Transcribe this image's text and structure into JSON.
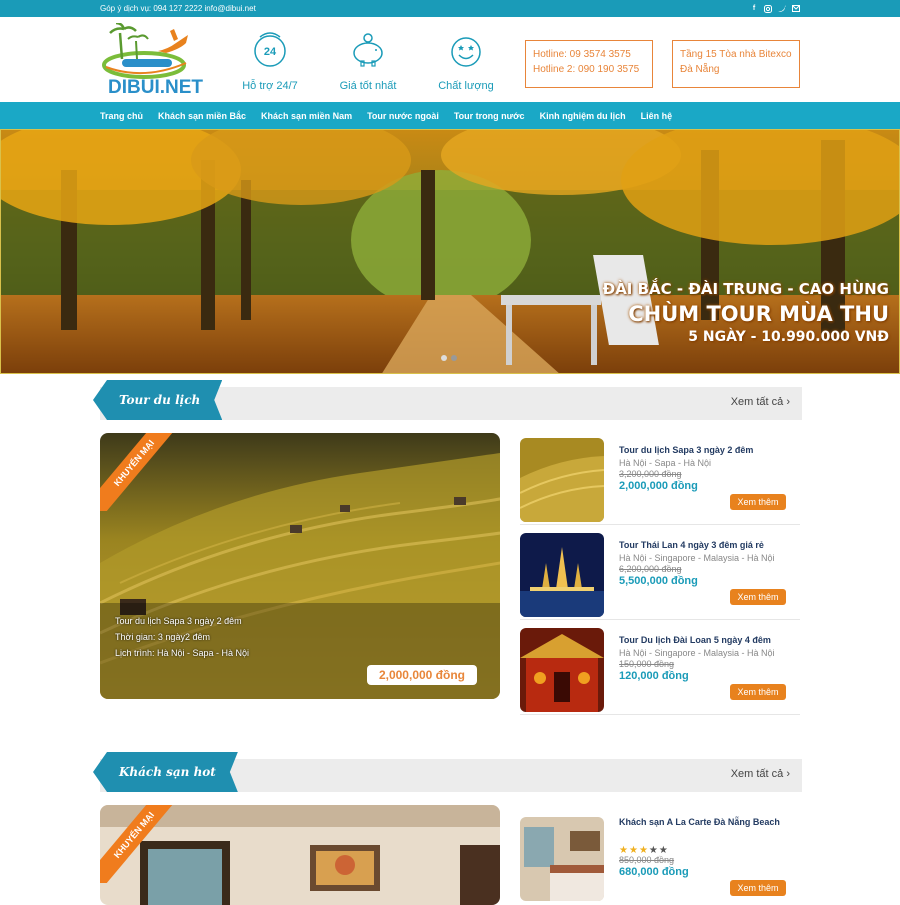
{
  "topbar": {
    "contact_text": "Góp ý dịch vụ: 094 127 2222 info@dibui.net",
    "social_icons": [
      "facebook-icon",
      "instagram-icon",
      "twitter-icon",
      "mail-icon"
    ]
  },
  "header": {
    "logo_text": "DIBUI.NET",
    "features": [
      {
        "label": "Hỗ trợ 24/7",
        "icon": "support-24-icon"
      },
      {
        "label": "Giá tốt nhất",
        "icon": "piggy-bank-icon"
      },
      {
        "label": "Chất lượng",
        "icon": "quality-icon"
      }
    ],
    "hotline_1": "Hotline: 09 3574 3575",
    "hotline_2": "Hotline 2: 090 190 3575",
    "address_1": "Tầng 15 Tòa nhà Bitexco",
    "address_2": "Đà Nẵng"
  },
  "nav": [
    "Trang chủ",
    "Khách sạn miền Bắc",
    "Khách sạn miền Nam",
    "Tour nước ngoài",
    "Tour trong nước",
    "Kinh nghiệm du lịch",
    "Liên hệ"
  ],
  "banner": {
    "line1": "ĐÀI BẮC - ĐÀI TRUNG - CAO HÙNG",
    "line2": "CHÙM TOUR MÙA THU",
    "line3": "5 NGÀY - 10.990.000 VNĐ"
  },
  "tours": {
    "heading": "Tour du lịch",
    "see_all": "Xem tất cả",
    "featured": {
      "badge": "KHUYẾN MẠI",
      "name": "Tour du lịch Sapa 3 ngày 2 đêm",
      "time": "Thời gian: 3 ngày2 đêm",
      "route": "Lịch trình: Hà Nội - Sapa - Hà Nội",
      "price": "2,000,000 đồng"
    },
    "items": [
      {
        "title": "Tour du lịch Sapa 3 ngày 2 đêm",
        "route": "Hà Nội - Sapa - Hà Nội",
        "old_price": "3,200,000 đồng",
        "price": "2,000,000 đồng",
        "button": "Xem thêm"
      },
      {
        "title": "Tour Thái Lan 4 ngày 3 đêm giá rẻ",
        "route": "Hà Nội - Singapore - Malaysia - Hà Nội",
        "old_price": "6,200,000 đồng",
        "price": "5,500,000 đồng",
        "button": "Xem thêm"
      },
      {
        "title": "Tour Du lịch Đài Loan 5 ngày 4 đêm",
        "route": "Hà Nội - Singapore - Malaysia - Hà Nội",
        "old_price": "150,000 đồng",
        "price": "120,000 đồng",
        "button": "Xem thêm"
      }
    ]
  },
  "hotels": {
    "heading": "Khách sạn hot",
    "see_all": "Xem tất cả",
    "featured": {
      "badge": "KHUYẾN MẠI"
    },
    "items": [
      {
        "title": "Khách sạn A La Carte Đà Nẵng Beach",
        "rating": 3,
        "max_rating": 5,
        "old_price": "850,000 đồng",
        "price": "680,000 đồng",
        "button": "Xem thêm"
      }
    ]
  },
  "colors": {
    "primary": "#1aa8c6",
    "accent": "#e8821e",
    "navy": "#233b62"
  }
}
